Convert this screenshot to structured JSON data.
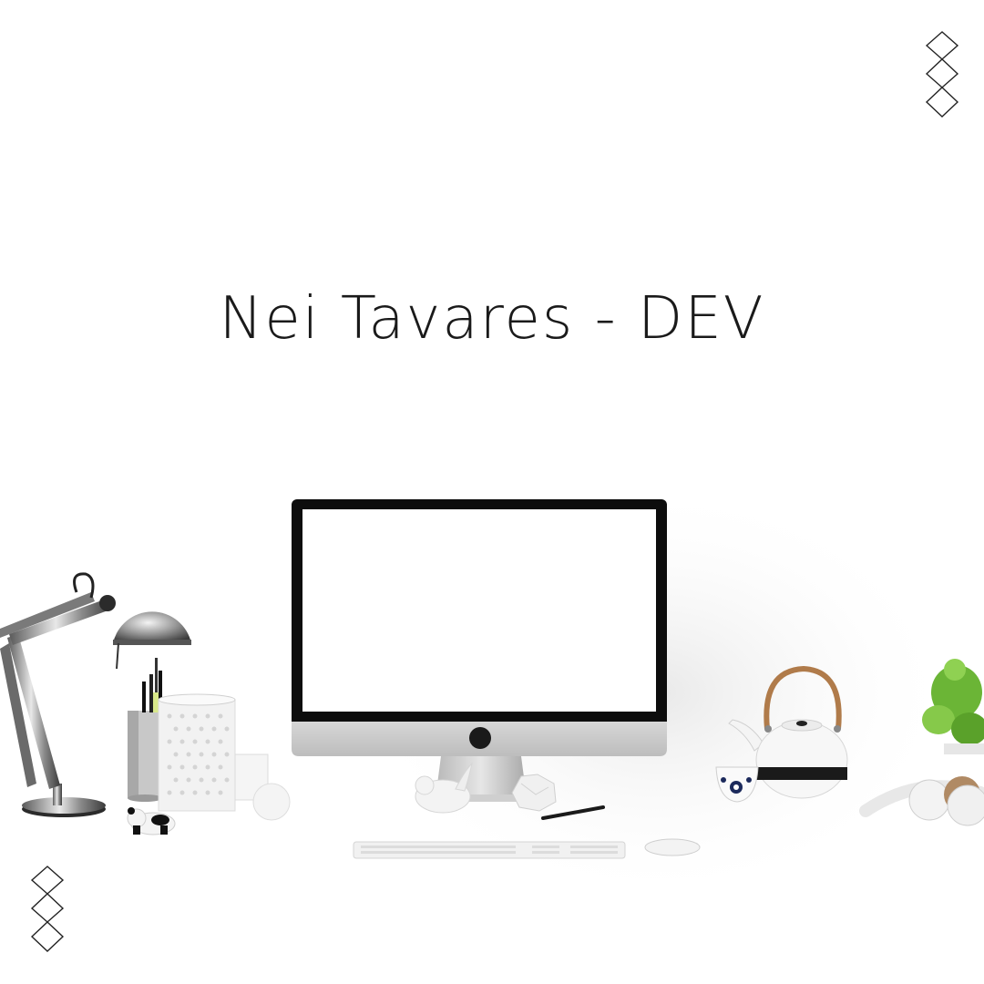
{
  "title": "Nei Tavares - DEV",
  "decorations": {
    "top_right": "diamond-chain-icon",
    "bottom_left": "diamond-chain-icon"
  },
  "scene_objects": [
    "desk-lamp",
    "pencil-cup",
    "perforated-candle-holder",
    "panda-figurine",
    "monitor",
    "bird-figurine",
    "crumpled-paper",
    "pen",
    "keyboard",
    "mouse",
    "teapot",
    "tea-cup",
    "headphones",
    "potted-plant"
  ]
}
